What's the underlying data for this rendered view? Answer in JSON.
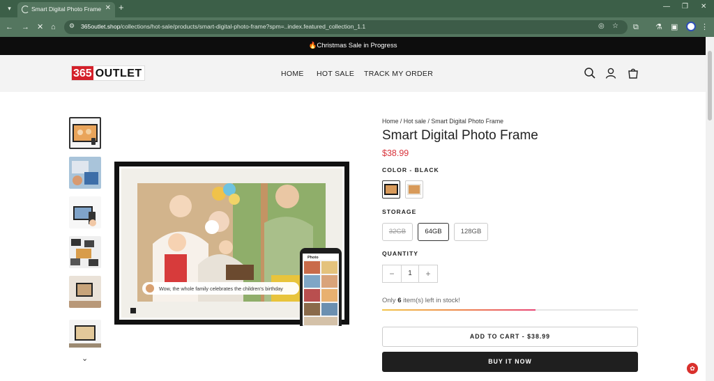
{
  "browser": {
    "tab_title": "Smart Digital Photo Frame",
    "url_domain": "365outlet.shop",
    "url_path": "/collections/hot-sale/products/smart-digital-photo-frame?spm=..index.featured_collection_1.1"
  },
  "announcement": {
    "text": "Christmas Sale in Progress"
  },
  "header": {
    "logo_number": "365",
    "logo_word": "OUTLET",
    "nav": [
      "HOME",
      "HOT SALE",
      "TRACK MY ORDER"
    ]
  },
  "product": {
    "breadcrumb": "Home / Hot sale / Smart Digital Photo Frame",
    "title": "Smart Digital Photo Frame",
    "price": "$38.99",
    "color_label": "COLOR - BLACK",
    "storage_label": "STORAGE",
    "storage_options": [
      "32GB",
      "64GB",
      "128GB"
    ],
    "quantity_label": "QUANTITY",
    "quantity": "1",
    "stock_prefix": "Only",
    "stock_count": "6",
    "stock_suffix": "item(s) left in stock!",
    "stock_fraction": 0.6,
    "add_to_cart": "ADD TO CART - $38.99",
    "buy_now": "BUY IT NOW",
    "image_caption": "Wow, the whole family celebrates the children's birthday",
    "phone_header": "Photo"
  },
  "colors": {
    "accent_price": "#d8323a",
    "buy_button": "#1f1f1f"
  }
}
